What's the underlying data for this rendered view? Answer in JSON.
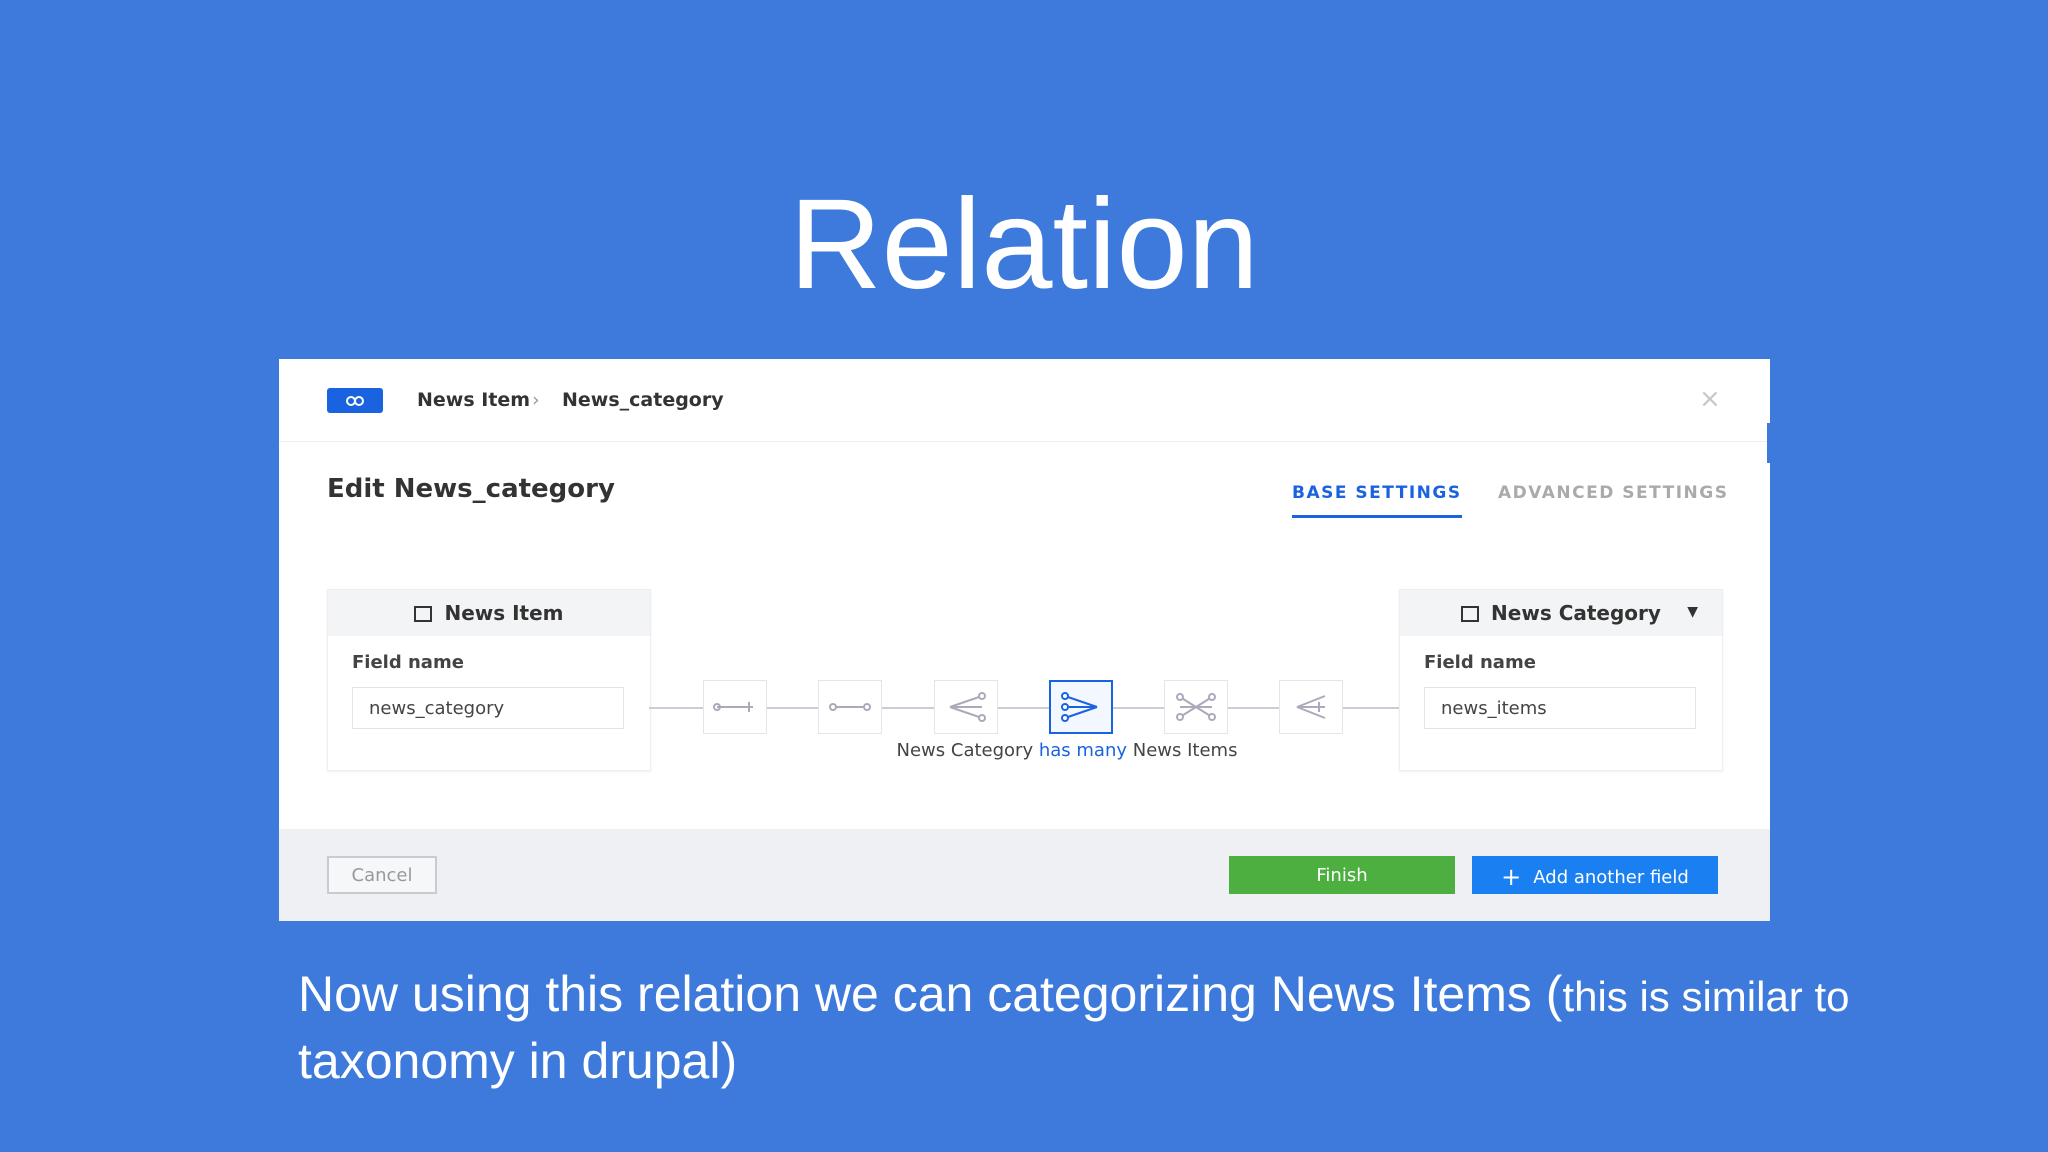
{
  "slide": {
    "title": "Relation",
    "caption_main": "Now using this relation we can categorizing News Items (",
    "caption_small": "this is similar to",
    "caption_line2": "taxonomy in drupal",
    "caption_close": ")"
  },
  "modal": {
    "badge_icon": "link-icon",
    "breadcrumb": [
      "News Item",
      "News_category"
    ],
    "breadcrumb_sep": "›",
    "close_glyph": "×",
    "title": "Edit News_category",
    "tabs": [
      {
        "label": "BASE SETTINGS",
        "active": true
      },
      {
        "label": "ADVANCED SETTINGS",
        "active": false
      }
    ],
    "left_entity": {
      "name": "News Item",
      "field_label": "Field name",
      "field_value": "news_category"
    },
    "right_entity": {
      "name": "News Category",
      "field_label": "Field name",
      "field_value": "news_items",
      "caret": "▼"
    },
    "relations": [
      {
        "icon": "one-way-icon",
        "active": false
      },
      {
        "icon": "one-to-one-icon",
        "active": false
      },
      {
        "icon": "one-to-many-icon",
        "active": false
      },
      {
        "icon": "many-to-one-icon",
        "active": true
      },
      {
        "icon": "many-to-many-icon",
        "active": false
      },
      {
        "icon": "many-way-icon",
        "active": false
      }
    ],
    "relation_text": {
      "a": "News Category",
      "verb": "has many",
      "b": "News Items"
    },
    "buttons": {
      "cancel": "Cancel",
      "finish": "Finish",
      "add": "Add another field",
      "add_glyph": "+"
    },
    "colors": {
      "primary": "#1a63e0",
      "success": "#4caf3f",
      "background": "#3d7adb"
    }
  }
}
